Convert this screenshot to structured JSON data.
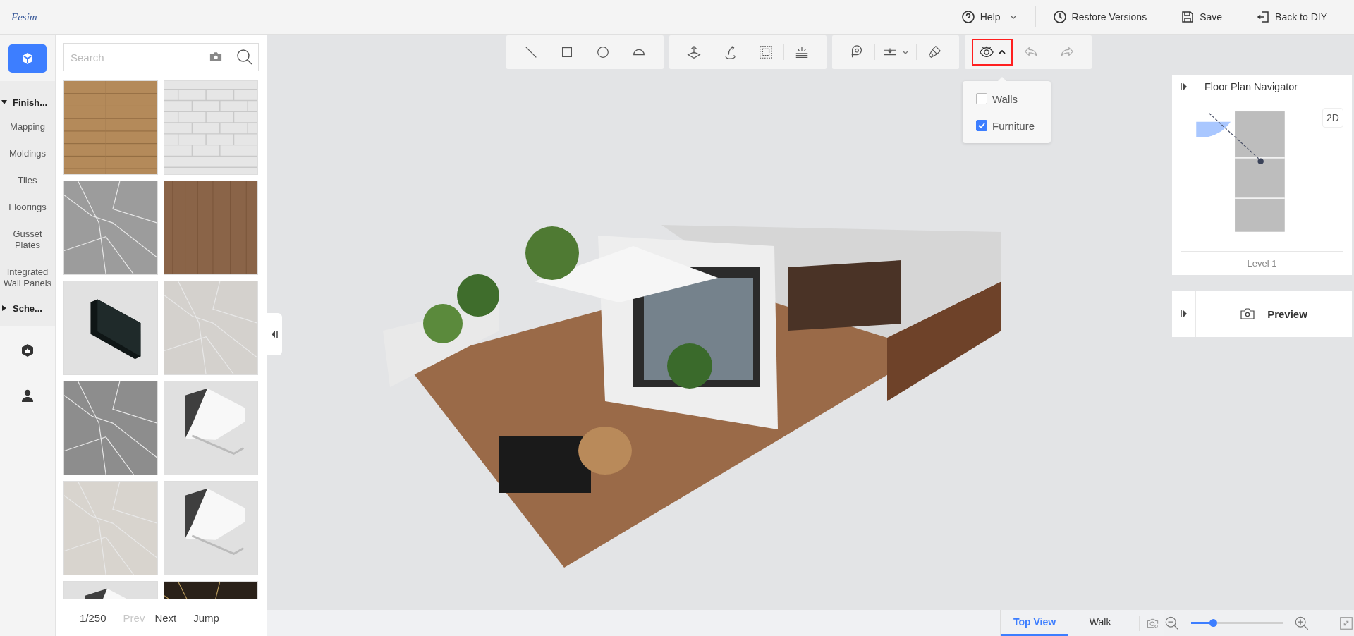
{
  "app": {
    "logo": "Fesim"
  },
  "header": {
    "actions": [
      {
        "kind": "help",
        "label": "Help"
      },
      {
        "kind": "restore",
        "label": "Restore Versions"
      },
      {
        "kind": "save",
        "label": "Save"
      },
      {
        "kind": "back",
        "label": "Back to DIY"
      }
    ]
  },
  "rail": {
    "top_selected": true,
    "groups": [
      {
        "label": "Finish...",
        "expanded": true,
        "children": [
          {
            "label": "Mapping"
          },
          {
            "label": "Moldings"
          },
          {
            "label": "Tiles"
          },
          {
            "label": "Floorings"
          },
          {
            "label": "Gusset Plates"
          },
          {
            "label": "Integrated Wall Panels"
          }
        ]
      },
      {
        "label": "Sche...",
        "expanded": false
      }
    ]
  },
  "catalog": {
    "search": {
      "placeholder": "Search"
    },
    "pager": {
      "page": "1/250",
      "prev": {
        "label": "Prev",
        "disabled": true
      },
      "next": {
        "label": "Next",
        "disabled": false
      },
      "jump": "Jump"
    }
  },
  "toolbar": {
    "groups": [
      [
        {
          "kind": "line",
          "selected": false,
          "disabled": false
        },
        {
          "kind": "rect",
          "selected": false,
          "disabled": false
        },
        {
          "kind": "circle",
          "selected": false,
          "disabled": false
        },
        {
          "kind": "arc",
          "selected": false,
          "disabled": false
        }
      ],
      [
        {
          "kind": "lift",
          "selected": false,
          "disabled": false
        },
        {
          "kind": "rotate",
          "selected": false,
          "disabled": false
        },
        {
          "kind": "frame",
          "selected": false,
          "disabled": false
        },
        {
          "kind": "light",
          "selected": false,
          "disabled": false
        }
      ],
      [
        {
          "kind": "tape",
          "selected": false,
          "disabled": false
        },
        {
          "kind": "level",
          "selected": false,
          "disabled": false
        },
        {
          "kind": "brush",
          "selected": false,
          "disabled": false
        }
      ],
      [
        {
          "kind": "eye",
          "selected": true,
          "disabled": false
        },
        {
          "kind": "undo",
          "selected": false,
          "disabled": true
        },
        {
          "kind": "redo",
          "selected": false,
          "disabled": true
        }
      ]
    ]
  },
  "visibility_menu": {
    "items": [
      {
        "label": "Walls",
        "checked": false
      },
      {
        "label": "Furniture",
        "checked": true
      }
    ]
  },
  "navigator": {
    "title": "Floor Plan Navigator",
    "mode_button": "2D",
    "level": "Level 1"
  },
  "preview": {
    "label": "Preview"
  },
  "view_tabs": [
    {
      "label": "Top View",
      "selected": true
    },
    {
      "label": "Walk",
      "selected": false
    }
  ],
  "zoom": {
    "level": 0.24
  }
}
